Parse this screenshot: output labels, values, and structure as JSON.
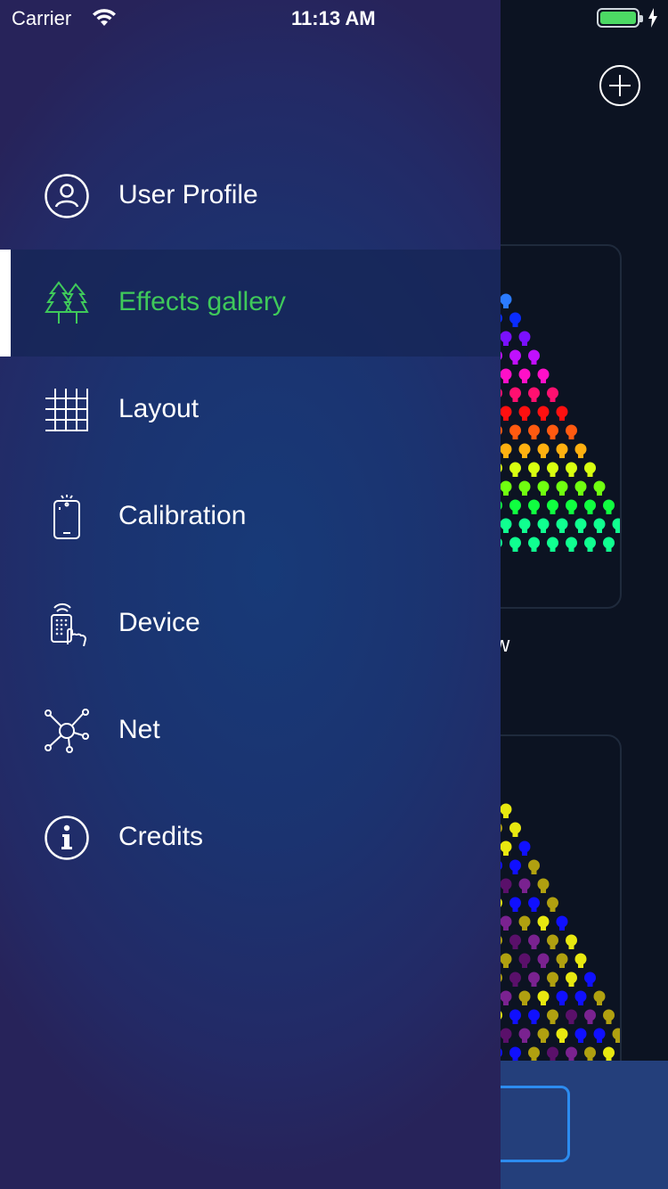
{
  "status_bar": {
    "carrier": "Carrier",
    "time": "11:13 AM"
  },
  "background": {
    "card_title_fragment": "w",
    "colors": {
      "accent_blue": "#2c8cf0",
      "bottom_bar": "#243f7b"
    }
  },
  "menu": {
    "active_color": "#3fc95a",
    "items": [
      {
        "label": "User Profile",
        "icon": "user-profile-icon"
      },
      {
        "label": "Effects gallery",
        "icon": "trees-icon",
        "active": true
      },
      {
        "label": "Layout",
        "icon": "grid-icon"
      },
      {
        "label": "Calibration",
        "icon": "phone-calibration-icon"
      },
      {
        "label": "Device",
        "icon": "remote-device-icon"
      },
      {
        "label": "Net",
        "icon": "network-icon"
      },
      {
        "label": "Credits",
        "icon": "info-icon"
      }
    ]
  }
}
